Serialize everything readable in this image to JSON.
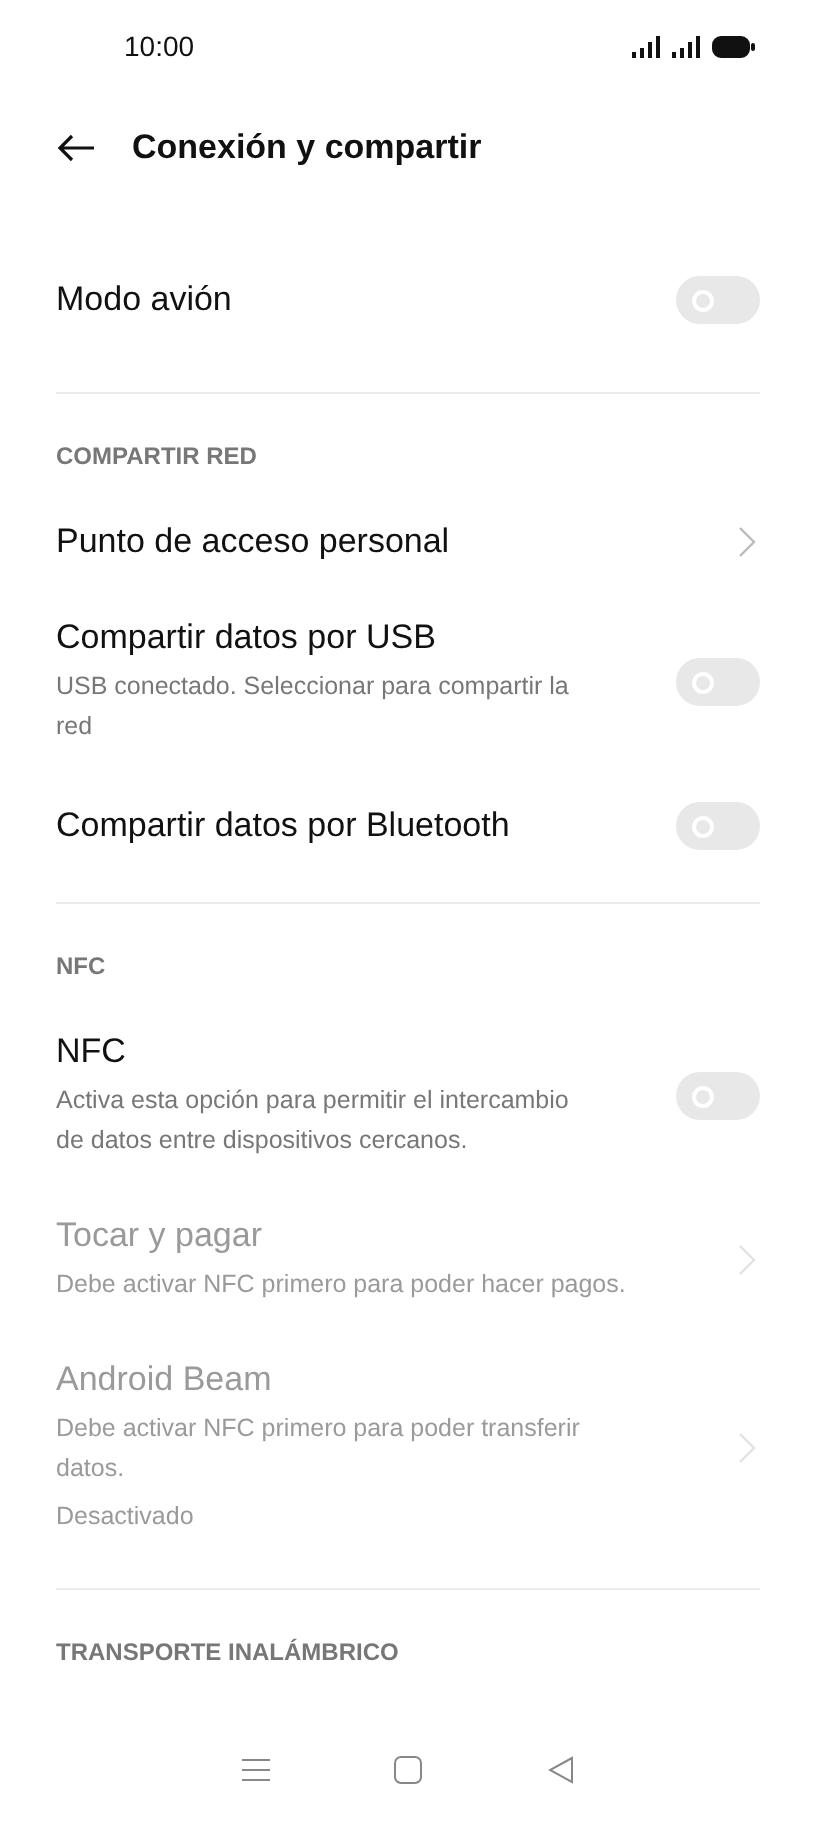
{
  "status_bar": {
    "time": "10:00"
  },
  "header": {
    "title": "Conexión y compartir"
  },
  "sections": [
    {
      "items": [
        {
          "kind": "toggle",
          "title": "Modo avión",
          "on": false,
          "disabled": false
        }
      ]
    },
    {
      "heading": "COMPARTIR RED",
      "items": [
        {
          "kind": "link",
          "title": "Punto de acceso personal",
          "disabled": false
        },
        {
          "kind": "toggle",
          "title": "Compartir datos por USB",
          "summary": "USB conectado. Seleccionar para compartir la red",
          "on": false,
          "disabled": false
        },
        {
          "kind": "toggle",
          "title": "Compartir datos por Bluetooth",
          "on": false,
          "disabled": false
        }
      ]
    },
    {
      "heading": "NFC",
      "items": [
        {
          "kind": "toggle",
          "title": "NFC",
          "summary": "Activa esta opción para permitir el intercambio de datos entre dispositivos cercanos.",
          "on": false,
          "disabled": false
        },
        {
          "kind": "link",
          "title": "Tocar y pagar",
          "summary": "Debe activar NFC primero para poder hacer pagos.",
          "disabled": true
        },
        {
          "kind": "link",
          "title": "Android Beam",
          "summary": "Debe activar NFC primero para poder transferir datos.",
          "status": "Desactivado",
          "disabled": true
        }
      ]
    },
    {
      "heading": "TRANSPORTE INALÁMBRICO"
    }
  ]
}
